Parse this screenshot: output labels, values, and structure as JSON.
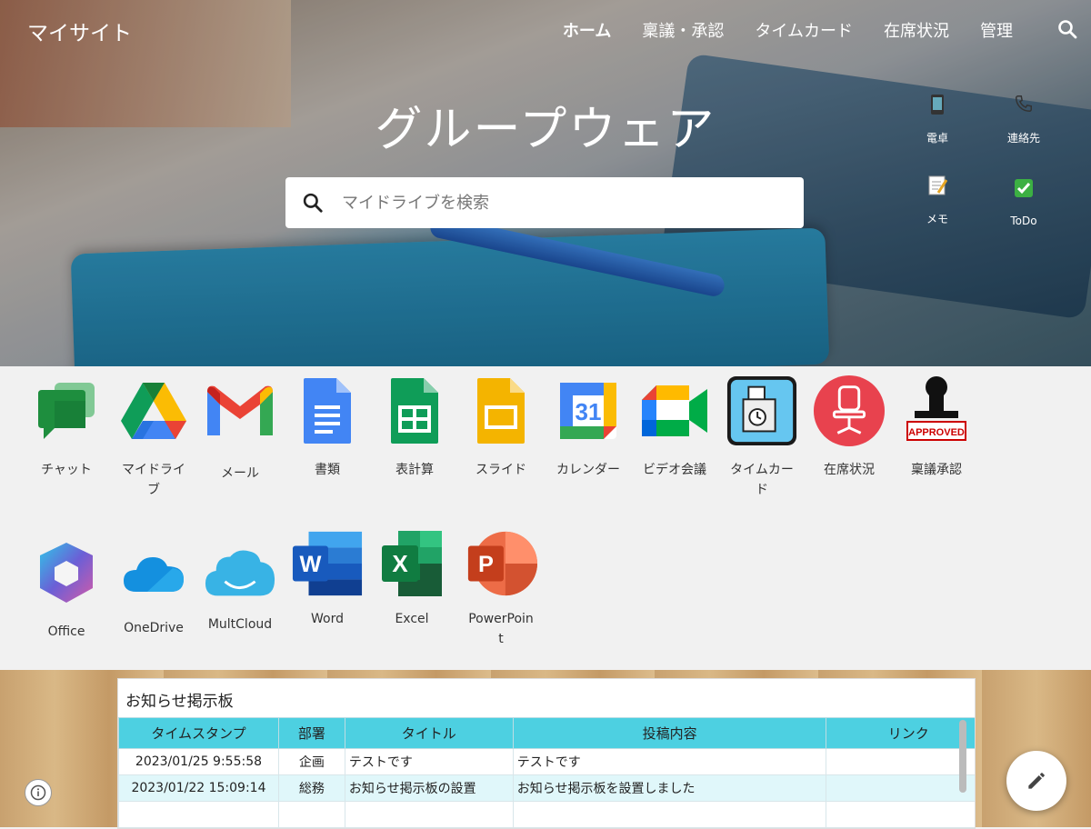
{
  "site_title": "マイサイト",
  "nav": {
    "items": [
      "ホーム",
      "稟議・承認",
      "タイムカード",
      "在席状況",
      "管理"
    ]
  },
  "hero": {
    "title": "グループウェア",
    "search_placeholder": "マイドライブを検索"
  },
  "quick_links": [
    {
      "label": "電卓",
      "icon": "phone-icon"
    },
    {
      "label": "連絡先",
      "icon": "telephone-icon"
    },
    {
      "label": "メモ",
      "icon": "memo-icon"
    },
    {
      "label": "ToDo",
      "icon": "checkbox-icon"
    }
  ],
  "apps_row1": [
    {
      "label": "チャット",
      "icon": "chat-icon"
    },
    {
      "label": "マイドライブ",
      "icon": "drive-icon"
    },
    {
      "label": "メール",
      "icon": "gmail-icon"
    },
    {
      "label": "書類",
      "icon": "docs-icon"
    },
    {
      "label": "表計算",
      "icon": "sheets-icon"
    },
    {
      "label": "スライド",
      "icon": "slides-icon"
    },
    {
      "label": "カレンダー",
      "icon": "calendar-icon"
    },
    {
      "label": "ビデオ会議",
      "icon": "meet-icon"
    },
    {
      "label": "タイムカード",
      "icon": "timecard-icon"
    },
    {
      "label": "在席状況",
      "icon": "chair-icon"
    },
    {
      "label": "稟議承認",
      "icon": "approved-stamp-icon"
    }
  ],
  "apps_row2": [
    {
      "label": "Office",
      "icon": "office-icon"
    },
    {
      "label": "OneDrive",
      "icon": "onedrive-icon"
    },
    {
      "label": "MultCloud",
      "icon": "multcloud-icon"
    },
    {
      "label": "Word",
      "icon": "word-icon"
    },
    {
      "label": "Excel",
      "icon": "excel-icon"
    },
    {
      "label": "PowerPoint",
      "icon": "powerpoint-icon"
    }
  ],
  "calendar_day": "31",
  "stamp_text": "APPROVED",
  "board": {
    "title": "お知らせ掲示板",
    "columns": [
      "タイムスタンプ",
      "部署",
      "タイトル",
      "投稿内容",
      "リンク"
    ],
    "rows": [
      [
        "2023/01/25 9:55:58",
        "企画",
        "テストです",
        "テストです",
        ""
      ],
      [
        "2023/01/22 15:09:14",
        "総務",
        "お知らせ掲示板の設置",
        "お知らせ掲示板を設置しました",
        ""
      ]
    ]
  },
  "colors": {
    "table_header": "#4dd0e1",
    "table_alt_row": "#e0f7fa"
  }
}
